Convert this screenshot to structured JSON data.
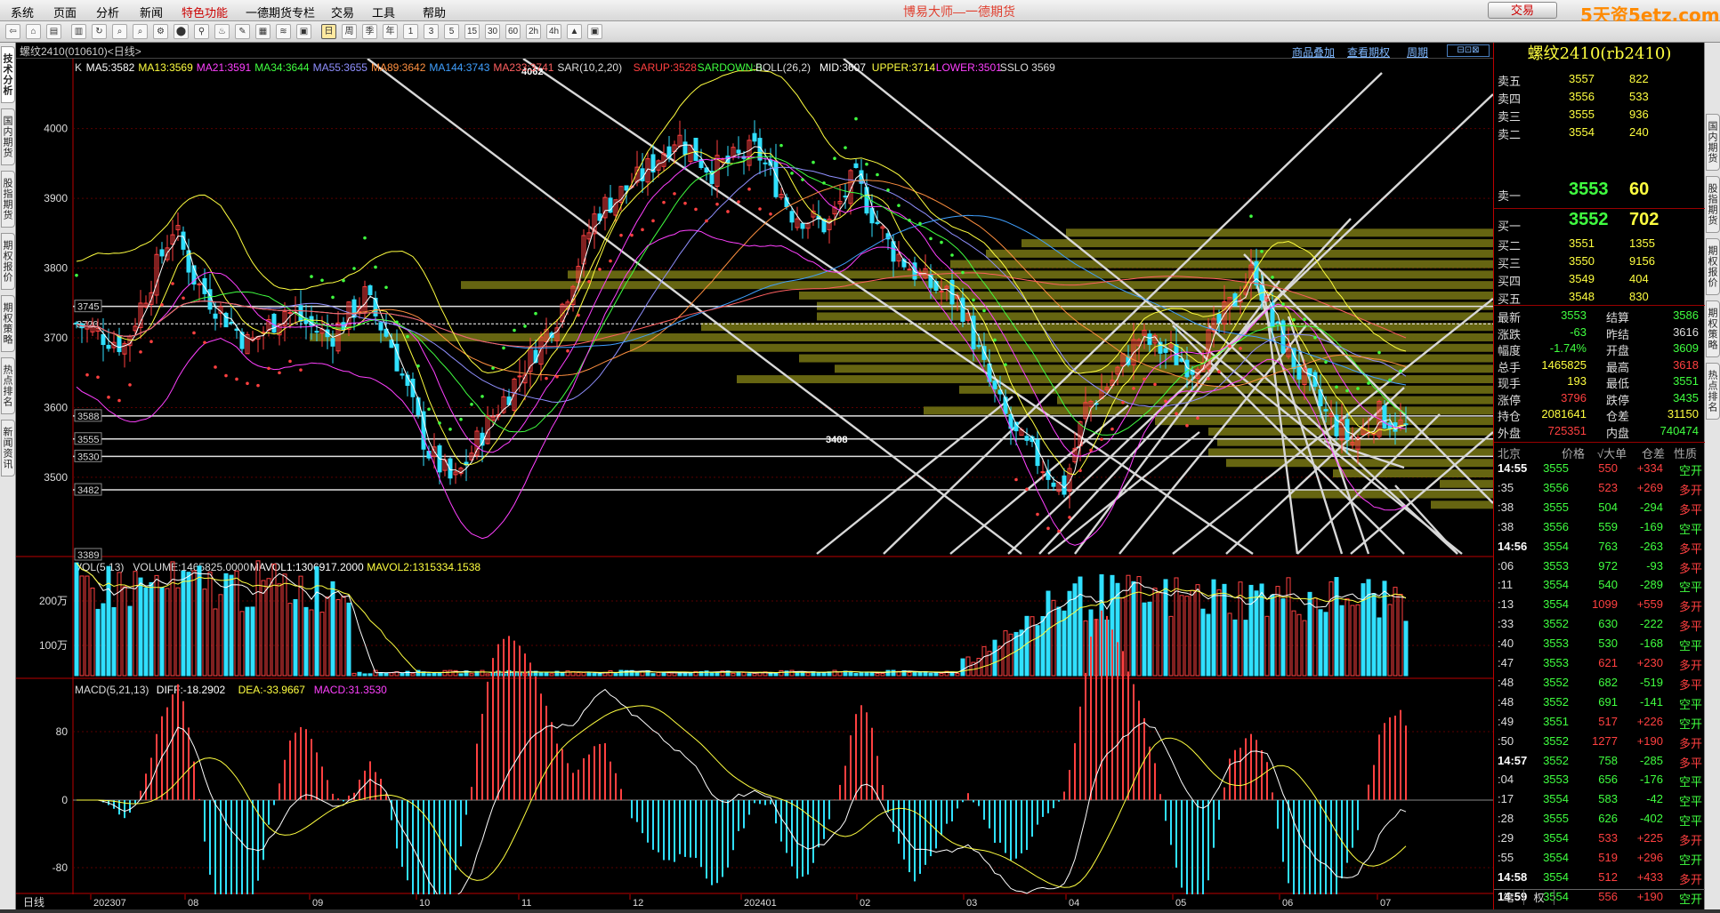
{
  "app": {
    "menu": [
      "系统",
      "页面",
      "分析",
      "新闻",
      "特色功能",
      "一德期货专栏",
      "交易",
      "工具",
      "帮助"
    ],
    "title": "博易大师—一德期货",
    "trade_label": "交易",
    "logo_text": "5天资5etz.com"
  },
  "left_tabs": [
    "技术分析",
    "国内期货",
    "股指期货",
    "期权报价",
    "期权策略",
    "热点排名",
    "新闻资讯"
  ],
  "right_tabs": [
    "国内期货",
    "股指期货",
    "期权报价",
    "期权策略",
    "热点排名"
  ],
  "chart_header": {
    "symbol": "螺纹2410(010610)<日线>",
    "links": [
      "商品叠加",
      "查看期权",
      "周期"
    ]
  },
  "indicators": {
    "ma_line": [
      {
        "text": "K",
        "color": "#dddddd"
      },
      {
        "text": "MA5:3582",
        "color": "#ffffff"
      },
      {
        "text": "MA13:3569",
        "color": "#ffff40"
      },
      {
        "text": "MA21:3591",
        "color": "#ff40ff"
      },
      {
        "text": "MA34:3644",
        "color": "#40ff40"
      },
      {
        "text": "MA55:3655",
        "color": "#9090ff"
      },
      {
        "text": "MA89:3642",
        "color": "#ff9040"
      },
      {
        "text": "MA144:3743",
        "color": "#40a0ff"
      },
      {
        "text": "MA233:3741",
        "color": "#ff6060"
      },
      {
        "text": "SAR(10,2,20)",
        "color": "#dddddd"
      },
      {
        "text": "SARUP:3528",
        "color": "#ff4040"
      },
      {
        "text": "SARDOWN:0",
        "color": "#40ff40"
      },
      {
        "text": "BOLL(26,2)",
        "color": "#dddddd"
      },
      {
        "text": "MID:3607",
        "color": "#ffffff"
      },
      {
        "text": "UPPER:3714",
        "color": "#ffff40"
      },
      {
        "text": "LOWER:3501",
        "color": "#ff40ff"
      },
      {
        "text": "SSLO 3569",
        "color": "#dddddd"
      }
    ],
    "vol_line": [
      {
        "text": "VOL(5,13)",
        "color": "#dddddd"
      },
      {
        "text": "VOLUME:1465825.0000",
        "color": "#dddddd"
      },
      {
        "text": "MAVOL1:1306917.2000",
        "color": "#ffffff"
      },
      {
        "text": "MAVOL2:1315334.1538",
        "color": "#ffff40"
      }
    ],
    "macd_line": [
      {
        "text": "MACD(5,21,13)",
        "color": "#dddddd"
      },
      {
        "text": "DIFF:-18.2902",
        "color": "#ffffff"
      },
      {
        "text": "DEA:-33.9667",
        "color": "#ffff40"
      },
      {
        "text": "MACD:31.3530",
        "color": "#ff40ff"
      }
    ]
  },
  "chart_data": {
    "type": "candlestick",
    "price_ticks": [
      4000,
      3900,
      3800,
      3700,
      3600,
      3500
    ],
    "price_range": [
      3389,
      4090
    ],
    "level_labels": [
      3745,
      3588,
      3555,
      3530,
      3482,
      3389
    ],
    "level_3720_label": "3720",
    "high_label": "4062",
    "low_label": "3408",
    "vol_ticks": [
      "200万",
      "100万"
    ],
    "macd_ticks": [
      "80",
      "0",
      "-80"
    ],
    "x_labels": [
      "202307",
      "08",
      "09",
      "10",
      "11",
      "12",
      "202401",
      "02",
      "03",
      "04",
      "05",
      "06",
      "07"
    ],
    "period_label": "日线"
  },
  "quote": {
    "title": "螺纹2410(rb2410)",
    "asks": [
      {
        "label": "卖五",
        "price": "3557",
        "vol": "822"
      },
      {
        "label": "卖四",
        "price": "3556",
        "vol": "533"
      },
      {
        "label": "卖三",
        "price": "3555",
        "vol": "936"
      },
      {
        "label": "卖二",
        "price": "3554",
        "vol": "240"
      },
      {
        "label": "卖一",
        "price": "3553",
        "vol": "60"
      }
    ],
    "bids": [
      {
        "label": "买一",
        "price": "3552",
        "vol": "702"
      },
      {
        "label": "买二",
        "price": "3551",
        "vol": "1355"
      },
      {
        "label": "买三",
        "price": "3550",
        "vol": "9156"
      },
      {
        "label": "买四",
        "price": "3549",
        "vol": "404"
      },
      {
        "label": "买五",
        "price": "3548",
        "vol": "830"
      }
    ],
    "stats": [
      {
        "l": "最新",
        "lv": "3553",
        "lc": "#40ff40",
        "r": "结算",
        "rv": "3586",
        "rc": "#40ff40"
      },
      {
        "l": "涨跌",
        "lv": "-63",
        "lc": "#40ff40",
        "r": "昨结",
        "rv": "3616",
        "rc": "#dddddd"
      },
      {
        "l": "幅度",
        "lv": "-1.74%",
        "lc": "#40ff40",
        "r": "开盘",
        "rv": "3609",
        "rc": "#40ff40"
      },
      {
        "l": "总手",
        "lv": "1465825",
        "lc": "#ffff40",
        "r": "最高",
        "rv": "3618",
        "rc": "#ff4040"
      },
      {
        "l": "现手",
        "lv": "193",
        "lc": "#ffff40",
        "r": "最低",
        "rv": "3551",
        "rc": "#40ff40"
      },
      {
        "l": "涨停",
        "lv": "3796",
        "lc": "#ff4040",
        "r": "跌停",
        "rv": "3435",
        "rc": "#40ff40"
      },
      {
        "l": "持仓",
        "lv": "2081641",
        "lc": "#ffff40",
        "r": "仓差",
        "rv": "31150",
        "rc": "#ffff40"
      },
      {
        "l": "外盘",
        "lv": "725351",
        "lc": "#ff4040",
        "r": "内盘",
        "rv": "740474",
        "rc": "#40ff40"
      }
    ],
    "tick_header": [
      "北京",
      "价格",
      "√大单",
      "仓差",
      "性质"
    ],
    "ticks": [
      {
        "t": "14:55",
        "p": "3555",
        "v": "550",
        "c": "+334",
        "n": "空开",
        "major": true
      },
      {
        "t": ":35",
        "p": "3556",
        "v": "523",
        "c": "+269",
        "n": "多开"
      },
      {
        "t": ":38",
        "p": "3555",
        "v": "504",
        "c": "-294",
        "n": "多平"
      },
      {
        "t": ":38",
        "p": "3556",
        "v": "559",
        "c": "-169",
        "n": "空平"
      },
      {
        "t": "14:56",
        "p": "3554",
        "v": "763",
        "c": "-263",
        "n": "多平",
        "major": true
      },
      {
        "t": ":06",
        "p": "3553",
        "v": "972",
        "c": "-93",
        "n": "多平"
      },
      {
        "t": ":11",
        "p": "3554",
        "v": "540",
        "c": "-289",
        "n": "空平"
      },
      {
        "t": ":13",
        "p": "3554",
        "v": "1099",
        "c": "+559",
        "n": "多开"
      },
      {
        "t": ":33",
        "p": "3552",
        "v": "630",
        "c": "-222",
        "n": "多平"
      },
      {
        "t": ":40",
        "p": "3553",
        "v": "530",
        "c": "-168",
        "n": "空平"
      },
      {
        "t": ":47",
        "p": "3553",
        "v": "621",
        "c": "+230",
        "n": "多开"
      },
      {
        "t": ":48",
        "p": "3552",
        "v": "682",
        "c": "-519",
        "n": "多平"
      },
      {
        "t": ":48",
        "p": "3552",
        "v": "691",
        "c": "-141",
        "n": "空平"
      },
      {
        "t": ":49",
        "p": "3551",
        "v": "517",
        "c": "+226",
        "n": "空开"
      },
      {
        "t": ":50",
        "p": "3552",
        "v": "1277",
        "c": "+190",
        "n": "多开"
      },
      {
        "t": "14:57",
        "p": "3552",
        "v": "758",
        "c": "-285",
        "n": "多平",
        "major": true
      },
      {
        "t": ":04",
        "p": "3553",
        "v": "656",
        "c": "-176",
        "n": "空平"
      },
      {
        "t": ":17",
        "p": "3554",
        "v": "583",
        "c": "-42",
        "n": "空平"
      },
      {
        "t": ":28",
        "p": "3555",
        "v": "626",
        "c": "-402",
        "n": "空平"
      },
      {
        "t": ":29",
        "p": "3554",
        "v": "533",
        "c": "+225",
        "n": "多开"
      },
      {
        "t": ":55",
        "p": "3554",
        "v": "519",
        "c": "+296",
        "n": "空开"
      },
      {
        "t": "14:58",
        "p": "3554",
        "v": "512",
        "c": "+433",
        "n": "多开",
        "major": true
      },
      {
        "t": "14:59",
        "p": "3554",
        "v": "556",
        "c": "+190",
        "n": "空开",
        "major": true
      }
    ],
    "tabs": [
      "笔",
      "权"
    ]
  }
}
